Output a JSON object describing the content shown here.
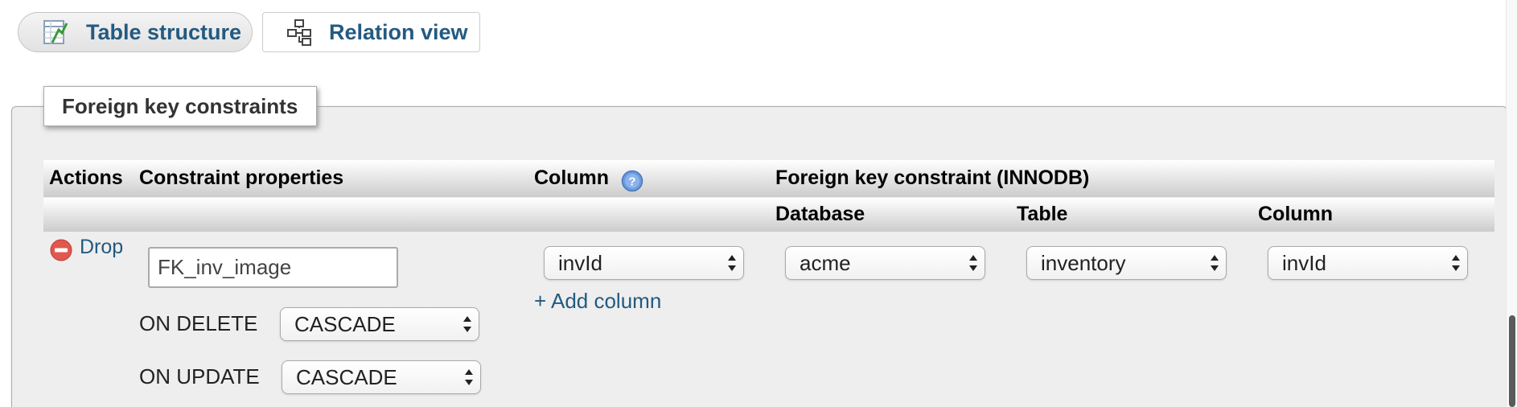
{
  "tabs": [
    {
      "label": "Table structure",
      "icon": "table-structure-icon",
      "active": true
    },
    {
      "label": "Relation view",
      "icon": "relation-view-icon",
      "active": false
    }
  ],
  "fieldset": {
    "legend": "Foreign key constraints"
  },
  "headers": {
    "actions": "Actions",
    "constraint_properties": "Constraint properties",
    "column": "Column",
    "foreign_key": "Foreign key constraint (INNODB)",
    "database": "Database",
    "table": "Table",
    "ref_column": "Column"
  },
  "row": {
    "drop_label": "Drop",
    "constraint_name": "FK_inv_image",
    "on_delete_label": "ON DELETE",
    "on_delete_value": "CASCADE",
    "on_update_label": "ON UPDATE",
    "on_update_value": "CASCADE",
    "column_value": "invId",
    "add_column_label": "+ Add column",
    "database_value": "acme",
    "table_value": "inventory",
    "ref_column_value": "invId"
  },
  "colors": {
    "link": "#235a81",
    "fieldset_bg": "#eeeeee",
    "drop_icon": "#e0584f",
    "help_icon": "#5b8fd6"
  }
}
